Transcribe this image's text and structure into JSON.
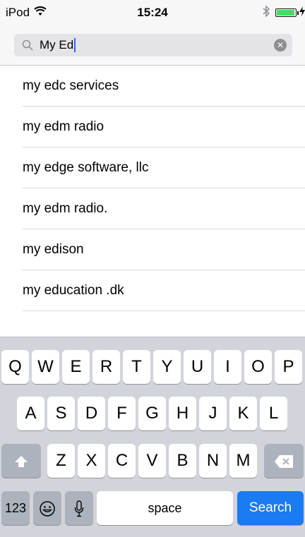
{
  "status_bar": {
    "device": "iPod",
    "time": "15:24",
    "wifi_icon": "wifi-icon",
    "bluetooth_icon": "bluetooth-icon",
    "battery_level": 0.95,
    "battery_color": "#4cd964"
  },
  "search": {
    "value": "My Ed",
    "search_icon": "search-icon",
    "clear_icon": "clear-icon"
  },
  "suggestions": [
    "my edc services",
    "my edm radio",
    "my edge software, llc",
    "my edm radio.",
    "my edison",
    "my education .dk"
  ],
  "keyboard": {
    "row1": [
      "Q",
      "W",
      "E",
      "R",
      "T",
      "Y",
      "U",
      "I",
      "O",
      "P"
    ],
    "row2": [
      "A",
      "S",
      "D",
      "F",
      "G",
      "H",
      "J",
      "K",
      "L"
    ],
    "row3": [
      "Z",
      "X",
      "C",
      "V",
      "B",
      "N",
      "M"
    ],
    "shift_icon": "shift-icon",
    "delete_icon": "delete-icon",
    "numbers_label": "123",
    "emoji_icon": "emoji-icon",
    "mic_icon": "microphone-icon",
    "space_label": "space",
    "action_label": "Search",
    "action_color": "#1a7bf2"
  }
}
